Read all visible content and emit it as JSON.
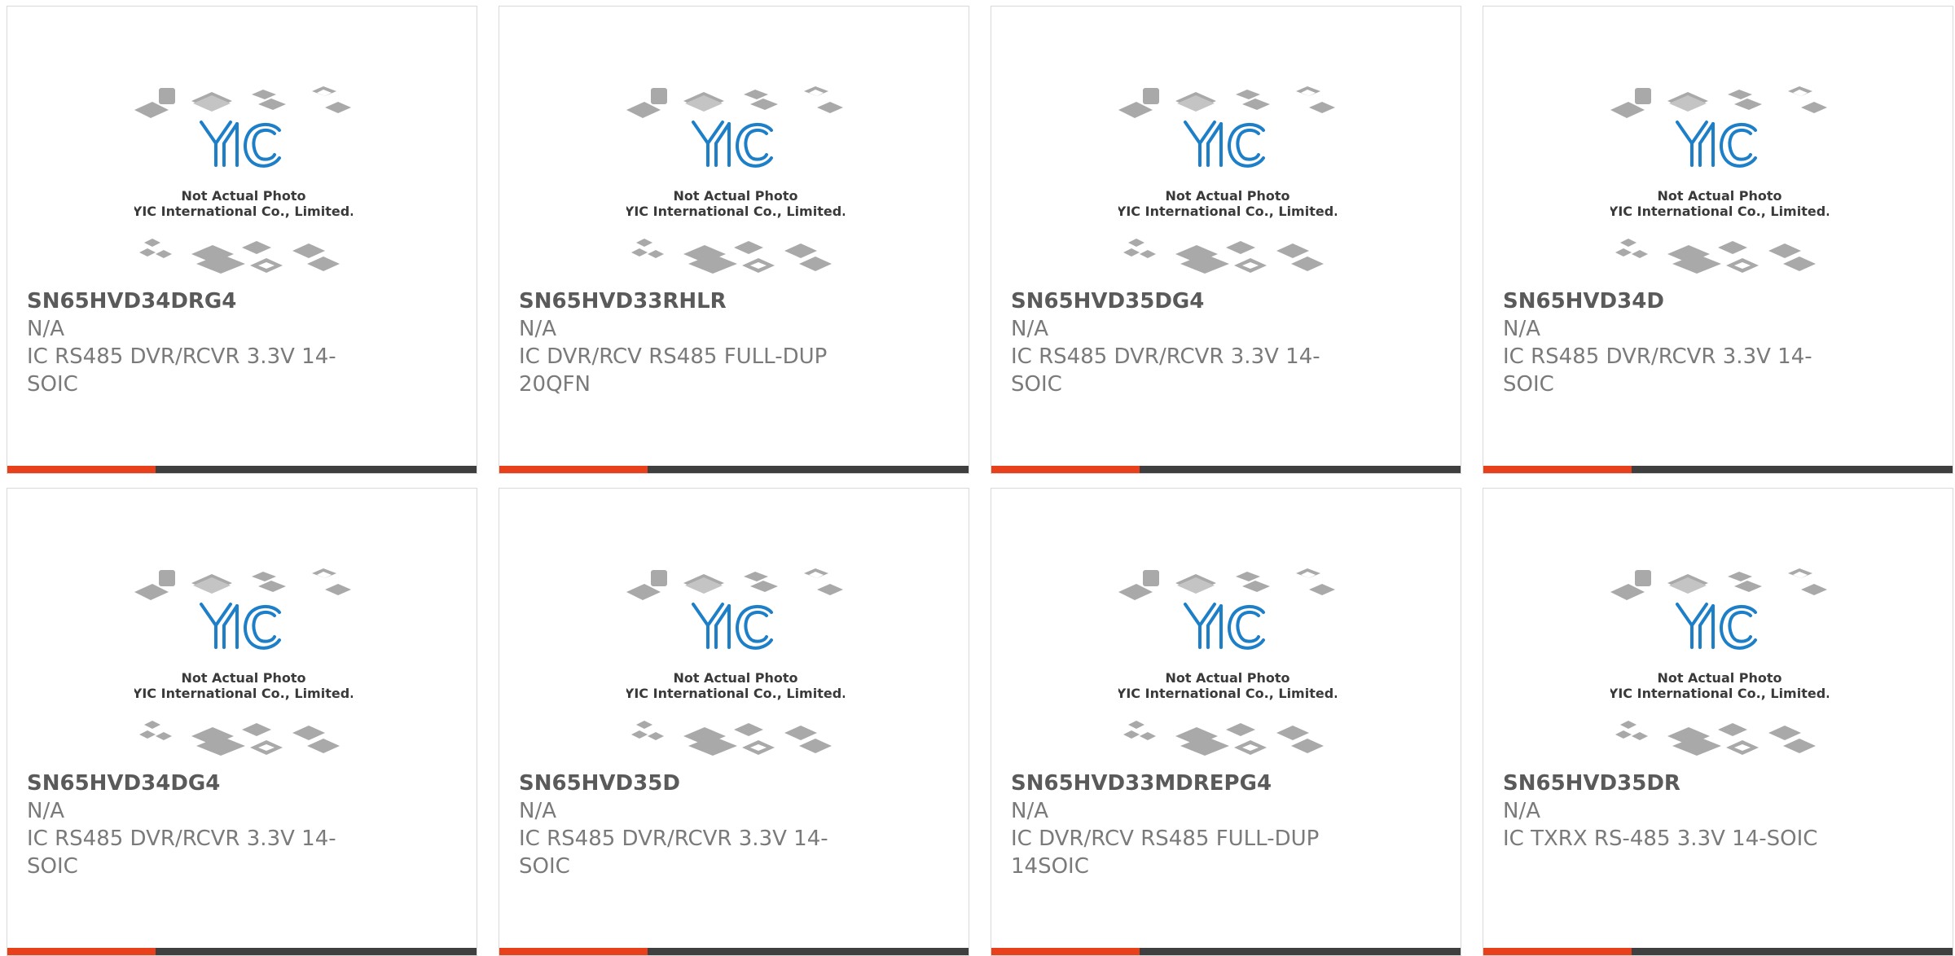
{
  "brand": {
    "accent_color": "#e8401a",
    "bar_color": "#3f3f3f",
    "logo_color": "#1e7fc9"
  },
  "placeholder_image": {
    "logo_text": "YIC",
    "caption_line1": "Not Actual Photo",
    "caption_line2": "YIC International Co., Limited."
  },
  "products": [
    {
      "part_number": "SN65HVD34DRG4",
      "manufacturer": "N/A",
      "description": "IC RS485 DVR/RCVR 3.3V 14-SOIC"
    },
    {
      "part_number": "SN65HVD33RHLR",
      "manufacturer": "N/A",
      "description": "IC DVR/RCV RS485 FULL-DUP 20QFN"
    },
    {
      "part_number": "SN65HVD35DG4",
      "manufacturer": "N/A",
      "description": "IC RS485 DVR/RCVR 3.3V 14-SOIC"
    },
    {
      "part_number": "SN65HVD34D",
      "manufacturer": "N/A",
      "description": "IC RS485 DVR/RCVR 3.3V 14-SOIC"
    },
    {
      "part_number": "SN65HVD34DG4",
      "manufacturer": "N/A",
      "description": "IC RS485 DVR/RCVR 3.3V 14-SOIC"
    },
    {
      "part_number": "SN65HVD35D",
      "manufacturer": "N/A",
      "description": "IC RS485 DVR/RCVR 3.3V 14-SOIC"
    },
    {
      "part_number": "SN65HVD33MDREPG4",
      "manufacturer": "N/A",
      "description": "IC DVR/RCV RS485 FULL-DUP 14SOIC"
    },
    {
      "part_number": "SN65HVD35DR",
      "manufacturer": "N/A",
      "description": "IC TXRX RS-485 3.3V 14-SOIC"
    }
  ]
}
